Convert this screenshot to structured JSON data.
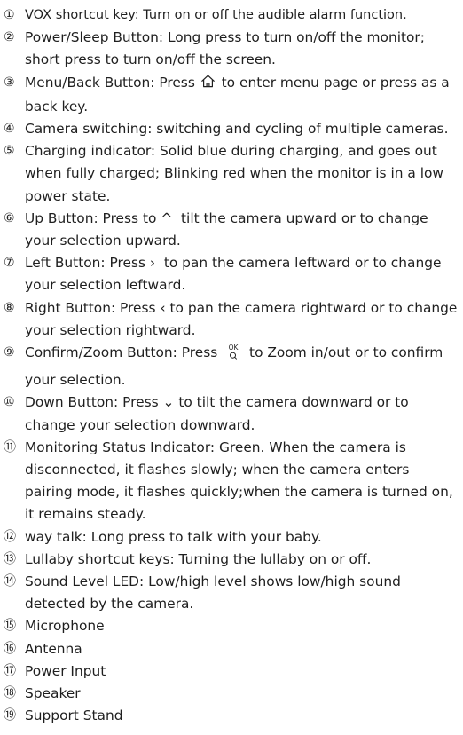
{
  "items": [
    {
      "num": "①",
      "text": "VOX shortcut key: Turn on or off the audible alarm function."
    },
    {
      "num": "②",
      "text": "Power/Sleep Button: Long press to turn on/off the monitor; short press to turn on/off the screen."
    },
    {
      "num": "③",
      "text_before": "Menu/Back Button: Press ",
      "icon": "home-icon",
      "text_after": " to enter menu page or press as a back key."
    },
    {
      "num": "④",
      "text": "Camera switching: switching and cycling of multiple cameras."
    },
    {
      "num": "⑤",
      "text": "Charging indicator: Solid blue during charging, and goes out when fully charged; Blinking red when the monitor is in a low power state."
    },
    {
      "num": "⑥",
      "text_before": "Up Button: Press to ",
      "glyph": "^",
      "text_after": "  tilt the camera upward or to change your selection upward."
    },
    {
      "num": "⑦",
      "text_before": "Left Button: Press ",
      "glyph": "›",
      "text_after": "  to pan the camera leftward or to change your selection leftward."
    },
    {
      "num": "⑧",
      "text_before": "Right Button: Press ",
      "glyph": "‹",
      "text_after": " to pan the camera rightward or to change your selection rightward."
    },
    {
      "num": "⑨",
      "text_before": "Confirm/Zoom Button: Press ",
      "icon": "ok-zoom-icon",
      "icon_text": "OK",
      "text_after": " to Zoom in/out or to confirm your selection."
    },
    {
      "num": "⑩",
      "text_before": "Down Button: Press ",
      "glyph": "⌄",
      "text_after": " to tilt the camera downward or to change your selection downward."
    },
    {
      "num": "⑪",
      "text": "Monitoring Status Indicator: Green. When the camera is disconnected, it flashes slowly; when the camera enters pairing mode, it flashes quickly;when the camera is turned on, it remains steady."
    },
    {
      "num": "⑫",
      "text": "way talk: Long press to talk with your baby."
    },
    {
      "num": "⑬",
      "text": "Lullaby shortcut keys: Turning the lullaby on or off."
    },
    {
      "num": "⑭",
      "text": "Sound Level LED: Low/high level shows low/high sound detected by the camera."
    },
    {
      "num": "⑮",
      "text": "Microphone"
    },
    {
      "num": "⑯",
      "text": "Antenna"
    },
    {
      "num": "⑰",
      "text": "Power Input"
    },
    {
      "num": "⑱",
      "text": "Speaker"
    },
    {
      "num": "⑲",
      "text": "Support Stand"
    }
  ]
}
